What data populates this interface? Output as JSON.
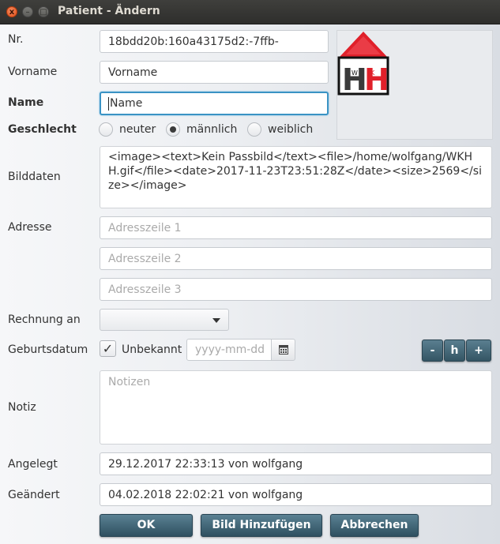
{
  "window": {
    "title": "Patient - Ändern",
    "close": "x",
    "min": "–",
    "max": "□"
  },
  "form": {
    "nr": {
      "label": "Nr.",
      "value": "18bdd20b:160a43175d2:-7ffb-"
    },
    "vorname": {
      "label": "Vorname",
      "value": "Vorname"
    },
    "name": {
      "label": "Name",
      "value": "Name"
    },
    "geschlecht": {
      "label": "Geschlecht",
      "options": [
        "neuter",
        "männlich",
        "weiblich"
      ],
      "selected": "männlich"
    },
    "bilddaten": {
      "label": "Bilddaten",
      "value": "<image><text>Kein Passbild</text><file>/home/wolfgang/WKHH.gif</file><date>2017-11-23T23:51:28Z</date><size>2569</size></image>"
    },
    "adresse": {
      "label": "Adresse",
      "placeholders": [
        "Adresszeile 1",
        "Adresszeile 2",
        "Adresszeile 3"
      ]
    },
    "rechnung": {
      "label": "Rechnung an",
      "value": ""
    },
    "geburtsdatum": {
      "label": "Geburtsdatum",
      "unbekannt_label": "Unbekannt",
      "unbekannt_checked": true,
      "placeholder": "yyyy-mm-dd",
      "minus": "-",
      "h": "h",
      "plus": "+"
    },
    "notiz": {
      "label": "Notiz",
      "placeholder": "Notizen"
    },
    "angelegt": {
      "label": "Angelegt",
      "value": "29.12.2017 22:33:13 von wolfgang"
    },
    "geaendert": {
      "label": "Geändert",
      "value": "04.02.2018 22:02:21 von wolfgang"
    }
  },
  "logo": {
    "letters": "HH",
    "small_left": "W",
    "small_right": "K",
    "colors": {
      "roof": "#e0202a",
      "black": "#111111",
      "red": "#e0202a"
    }
  },
  "buttons": {
    "ok": "OK",
    "bild": "Bild Hinzufügen",
    "abbrechen": "Abbrechen"
  },
  "colors": {
    "accent_button": "#3e6576",
    "focus": "#3a93c4",
    "titlebar": "#3b3b38"
  }
}
